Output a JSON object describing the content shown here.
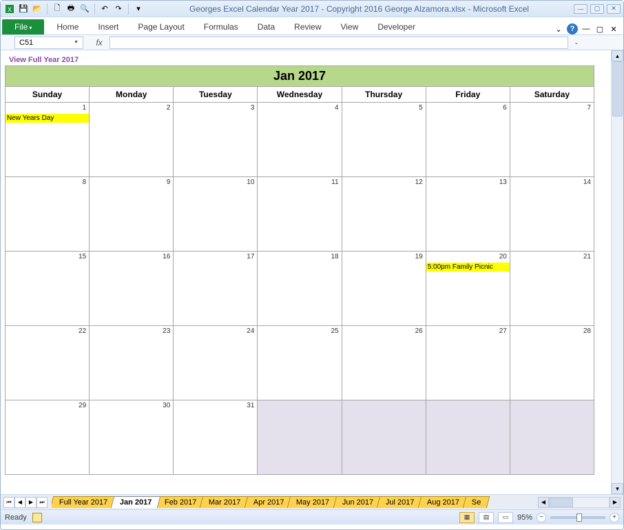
{
  "window": {
    "title": "Georges Excel Calendar Year 2017 - Copyright 2016 George Alzamora.xlsx - Microsoft Excel"
  },
  "qat": {
    "icons": [
      "excel-icon",
      "save-icon",
      "open-icon",
      "print-preview-icon",
      "print-icon",
      "find-icon",
      "undo-icon",
      "redo-icon"
    ]
  },
  "ribbon": {
    "file": "File",
    "tabs": [
      "Home",
      "Insert",
      "Page Layout",
      "Formulas",
      "Data",
      "Review",
      "View",
      "Developer"
    ]
  },
  "namebox": {
    "value": "C51"
  },
  "fx_label": "fx",
  "formula": {
    "value": ""
  },
  "view_link": "View Full Year 2017",
  "calendar": {
    "title": "Jan 2017",
    "days": [
      "Sunday",
      "Monday",
      "Tuesday",
      "Wednesday",
      "Thursday",
      "Friday",
      "Saturday"
    ],
    "weeks": [
      [
        {
          "n": "1",
          "event": "New Years Day"
        },
        {
          "n": "2"
        },
        {
          "n": "3"
        },
        {
          "n": "4"
        },
        {
          "n": "5"
        },
        {
          "n": "6"
        },
        {
          "n": "7"
        }
      ],
      [
        {
          "n": "8"
        },
        {
          "n": "9"
        },
        {
          "n": "10"
        },
        {
          "n": "11"
        },
        {
          "n": "12"
        },
        {
          "n": "13"
        },
        {
          "n": "14"
        }
      ],
      [
        {
          "n": "15"
        },
        {
          "n": "16"
        },
        {
          "n": "17"
        },
        {
          "n": "18"
        },
        {
          "n": "19"
        },
        {
          "n": "20",
          "event": "5:00pm Family Picnic"
        },
        {
          "n": "21"
        }
      ],
      [
        {
          "n": "22"
        },
        {
          "n": "23"
        },
        {
          "n": "24"
        },
        {
          "n": "25"
        },
        {
          "n": "26"
        },
        {
          "n": "27"
        },
        {
          "n": "28"
        }
      ],
      [
        {
          "n": "29"
        },
        {
          "n": "30"
        },
        {
          "n": "31"
        },
        {
          "n": "",
          "inactive": true
        },
        {
          "n": "",
          "inactive": true
        },
        {
          "n": "",
          "inactive": true
        },
        {
          "n": "",
          "inactive": true
        }
      ]
    ]
  },
  "sheet_tabs": {
    "active_index": 1,
    "tabs": [
      "Full Year 2017",
      "Jan 2017",
      "Feb 2017",
      "Mar 2017",
      "Apr 2017",
      "May 2017",
      "Jun 2017",
      "Jul 2017",
      "Aug 2017",
      "Se"
    ]
  },
  "status": {
    "ready": "Ready",
    "zoom": "95%"
  }
}
